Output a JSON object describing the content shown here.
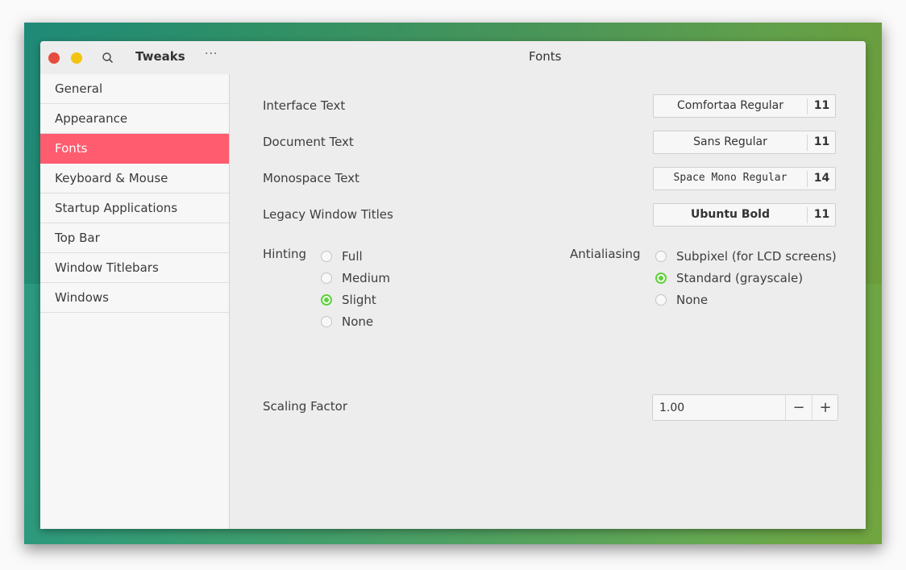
{
  "window": {
    "app_title": "Tweaks",
    "page_title": "Fonts",
    "menu_glyph": "···"
  },
  "sidebar": {
    "items": [
      {
        "label": "General",
        "active": false
      },
      {
        "label": "Appearance",
        "active": false
      },
      {
        "label": "Fonts",
        "active": true
      },
      {
        "label": "Keyboard & Mouse",
        "active": false
      },
      {
        "label": "Startup Applications",
        "active": false
      },
      {
        "label": "Top Bar",
        "active": false
      },
      {
        "label": "Window Titlebars",
        "active": false
      },
      {
        "label": "Windows",
        "active": false
      }
    ]
  },
  "fonts": {
    "rows": [
      {
        "label": "Interface Text",
        "font": "Comfortaa Regular",
        "size": "11"
      },
      {
        "label": "Document Text",
        "font": "Sans Regular",
        "size": "11"
      },
      {
        "label": "Monospace Text",
        "font": "Space Mono Regular",
        "size": "14"
      },
      {
        "label": "Legacy Window Titles",
        "font": "Ubuntu Bold",
        "size": "11"
      }
    ],
    "hinting": {
      "label": "Hinting",
      "options": [
        "Full",
        "Medium",
        "Slight",
        "None"
      ],
      "selected": "Slight"
    },
    "antialiasing": {
      "label": "Antialiasing",
      "options": [
        "Subpixel (for LCD screens)",
        "Standard (grayscale)",
        "None"
      ],
      "selected": "Standard (grayscale)"
    },
    "scaling": {
      "label": "Scaling Factor",
      "value": "1.00",
      "minus": "−",
      "plus": "+"
    }
  },
  "colors": {
    "accent": "#ff5c6f",
    "radio_checked": "#5fd13a",
    "close": "#e64d3d",
    "minimize": "#f2c40f"
  }
}
